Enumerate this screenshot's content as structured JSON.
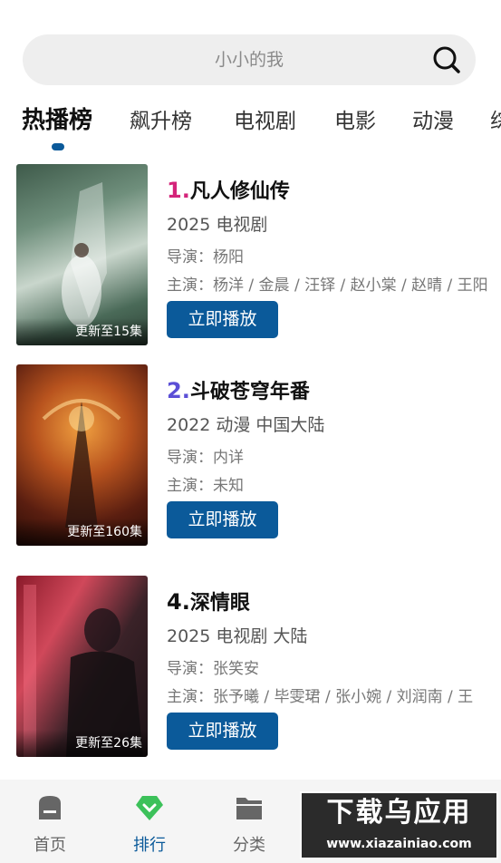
{
  "search": {
    "placeholder": "小小的我"
  },
  "tabs": [
    "热播榜",
    "飙升榜",
    "电视剧",
    "电影",
    "动漫",
    "综"
  ],
  "items": [
    {
      "rank": "1.",
      "title": "凡人修仙传",
      "rank_color": "#d4247a",
      "meta": "2025  电视剧",
      "director": "导演：杨阳",
      "cast": "主演：杨洋 / 金晨 / 汪铎 / 赵小棠 / 赵晴 / 王阳",
      "badge": "更新至15集",
      "play_label": "立即播放"
    },
    {
      "rank": "2.",
      "title": "斗破苍穹年番",
      "rank_color": "#5b4fd6",
      "meta": "2022  动漫  中国大陆",
      "director": "导演：内详",
      "cast": "主演：未知",
      "badge": "更新至160集",
      "play_label": "立即播放"
    },
    {
      "rank": "4.",
      "title": "深情眼",
      "rank_color": "#111111",
      "meta": "2025  电视剧  大陆",
      "director": "导演：张笑安",
      "cast": "主演：张予曦 / 毕雯珺 / 张小婉 / 刘润南 / 王",
      "badge": "更新至26集",
      "play_label": "立即播放"
    }
  ],
  "tabbar": [
    {
      "label": "首页",
      "icon": "home-icon"
    },
    {
      "label": "排行",
      "icon": "ranking-icon"
    },
    {
      "label": "分类",
      "icon": "folder-icon"
    }
  ],
  "watermark": {
    "main": "下载乌应用",
    "url": "www.xiazainiao.com"
  },
  "colors": {
    "accent": "#0b5a9a",
    "ranking_icon": "#3cc15a"
  }
}
